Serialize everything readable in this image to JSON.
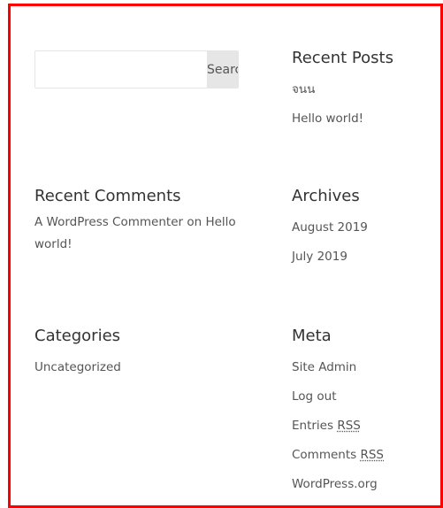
{
  "search": {
    "placeholder": "",
    "button_label": "Search"
  },
  "recent_posts": {
    "title": "Recent Posts",
    "items": [
      "จนน",
      "Hello world!"
    ]
  },
  "recent_comments": {
    "title": "Recent Comments",
    "author": "A WordPress Commenter",
    "on_word": "on",
    "post": "Hello world!"
  },
  "archives": {
    "title": "Archives",
    "items": [
      "August 2019",
      "July 2019"
    ]
  },
  "categories": {
    "title": "Categories",
    "items": [
      "Uncategorized"
    ]
  },
  "meta": {
    "title": "Meta",
    "site_admin": "Site Admin",
    "log_out": "Log out",
    "entries_prefix": "Entries",
    "comments_prefix": "Comments",
    "rss_abbr": "RSS",
    "wordpress_org": "WordPress.org"
  },
  "colors": {
    "frame_border": "#ff0000",
    "button_bg": "#e6e6e6"
  }
}
